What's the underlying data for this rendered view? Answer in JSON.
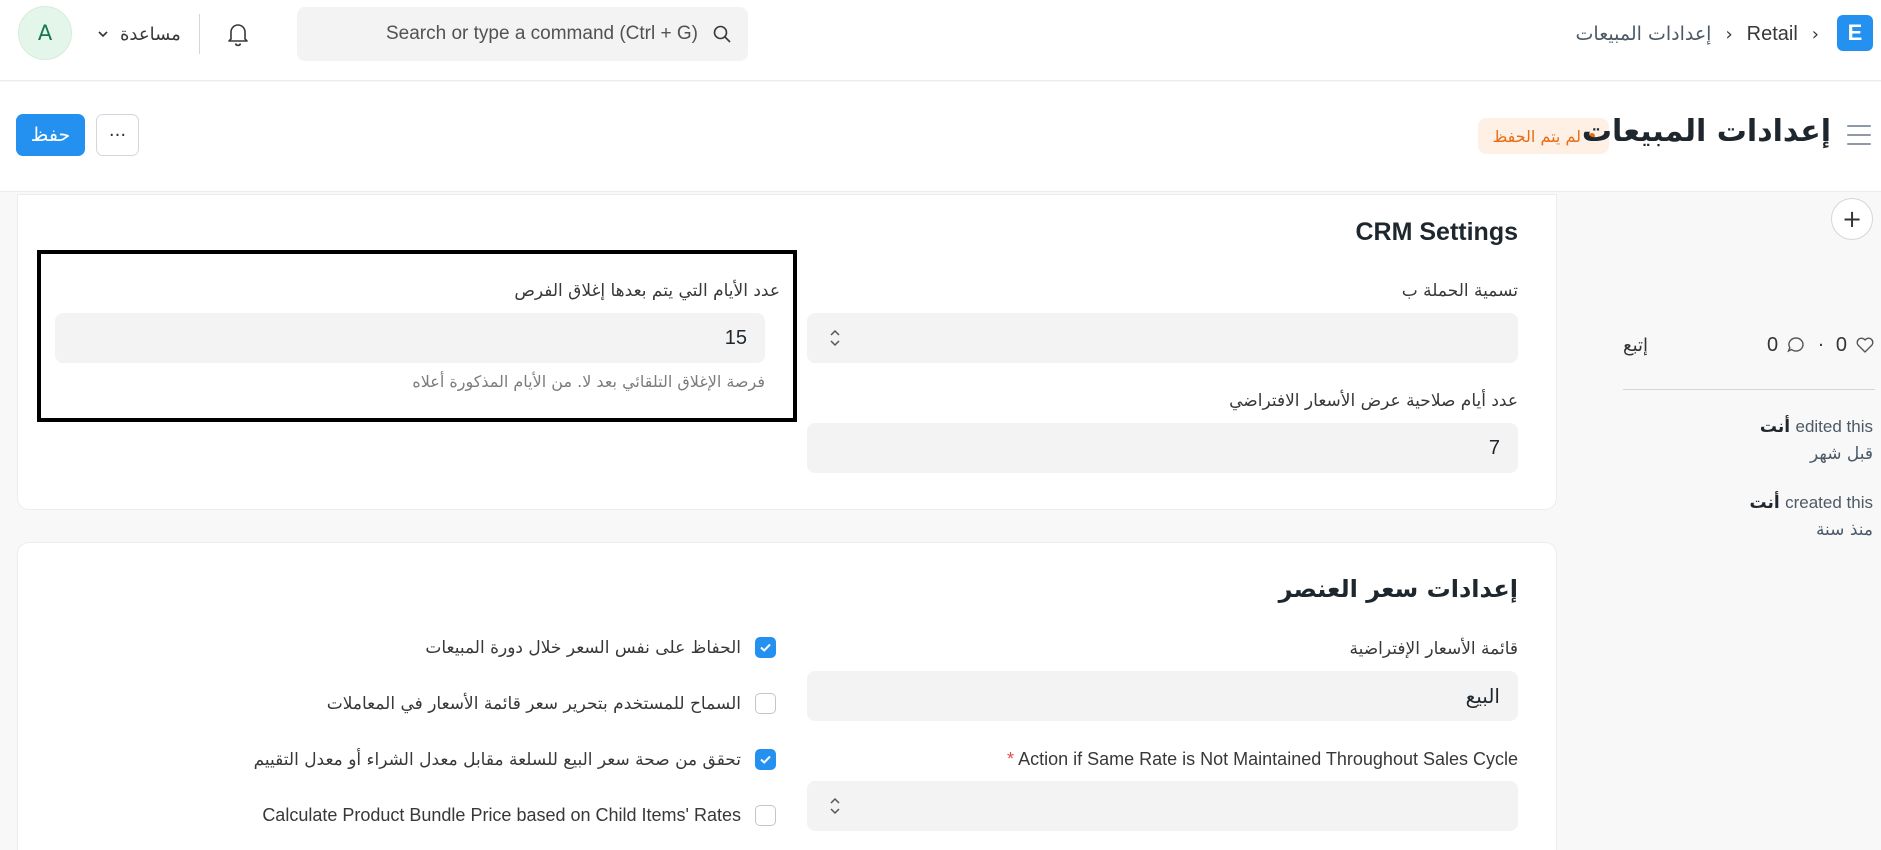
{
  "navbar": {
    "avatar_initial": "A",
    "help_label": "مساعدة",
    "search_placeholder": "Search or type a command (Ctrl + G)",
    "breadcrumbs": [
      "Retail",
      "إعدادات المبيعات"
    ],
    "brand_letter": "E"
  },
  "page_head": {
    "title": "إعدادات المبيعات",
    "status_badge": "لم يتم الحفظ",
    "save_label": "حفظ",
    "more_label": "···"
  },
  "sidebar": {
    "add_label": "+",
    "likes": "0",
    "comments": "0",
    "follow_label": "إتبع",
    "activity": [
      {
        "user": "أنت",
        "action": "edited this",
        "time": "قبل شهر"
      },
      {
        "user": "أنت",
        "action": "created this",
        "time": "منذ سنة"
      }
    ]
  },
  "crm_section": {
    "title": "CRM Settings",
    "campaign_naming": {
      "label": "تسمية الحملة ب",
      "value": ""
    },
    "quotation_validity": {
      "label": "عدد أيام صلاحية عرض الأسعار الافتراضي",
      "value": "7"
    },
    "close_opportunity": {
      "label": "عدد الأيام التي يتم بعدها إغلاق الفرص",
      "value": "15",
      "help": "فرصة الإغلاق التلقائي بعد لا. من الأيام المذكورة أعلاه"
    }
  },
  "item_price_section": {
    "title": "إعدادات سعر العنصر",
    "default_price_list": {
      "label": "قائمة الأسعار الإفتراضية",
      "value": "البيع"
    },
    "same_rate_action": {
      "label": "Action if Same Rate is Not Maintained Throughout Sales Cycle",
      "required_mark": "*",
      "value": ""
    },
    "checkboxes": [
      {
        "label": "الحفاظ على نفس السعر خلال دورة المبيعات",
        "checked": true
      },
      {
        "label": "السماح للمستخدم بتحرير سعر قائمة الأسعار في المعاملات",
        "checked": false
      },
      {
        "label": "تحقق من صحة سعر البيع للسلعة مقابل معدل الشراء أو معدل التقييم",
        "checked": true
      },
      {
        "label": "Calculate Product Bundle Price based on Child Items' Rates",
        "checked": false
      }
    ]
  },
  "colors": {
    "primary": "#2490ef",
    "badge_text": "#e86c13",
    "badge_bg": "#fff0e6"
  }
}
